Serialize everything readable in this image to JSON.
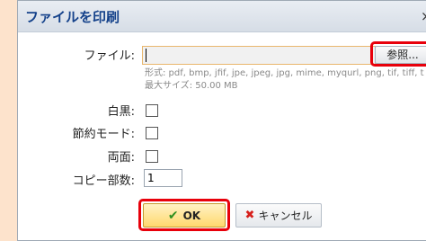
{
  "dialog": {
    "title": "ファイルを印刷",
    "close_glyph": "×"
  },
  "file": {
    "label": "ファイル:",
    "value": "",
    "browse_label": "参照...",
    "format_hint": "形式: pdf, bmp, jfif, jpe, jpeg, jpg, mime, myqurl, png, tif, tiff, t",
    "size_hint": "最大サイズ: 50.00 MB"
  },
  "options": {
    "bw_label": "白黒:",
    "eco_label": "節約モード:",
    "duplex_label": "両面:",
    "copies_label": "コピー部数:",
    "copies_value": "1"
  },
  "buttons": {
    "ok_label": "OK",
    "cancel_label": "キャンセル"
  },
  "icons": {
    "ok": "check-icon",
    "cancel": "x-icon"
  }
}
